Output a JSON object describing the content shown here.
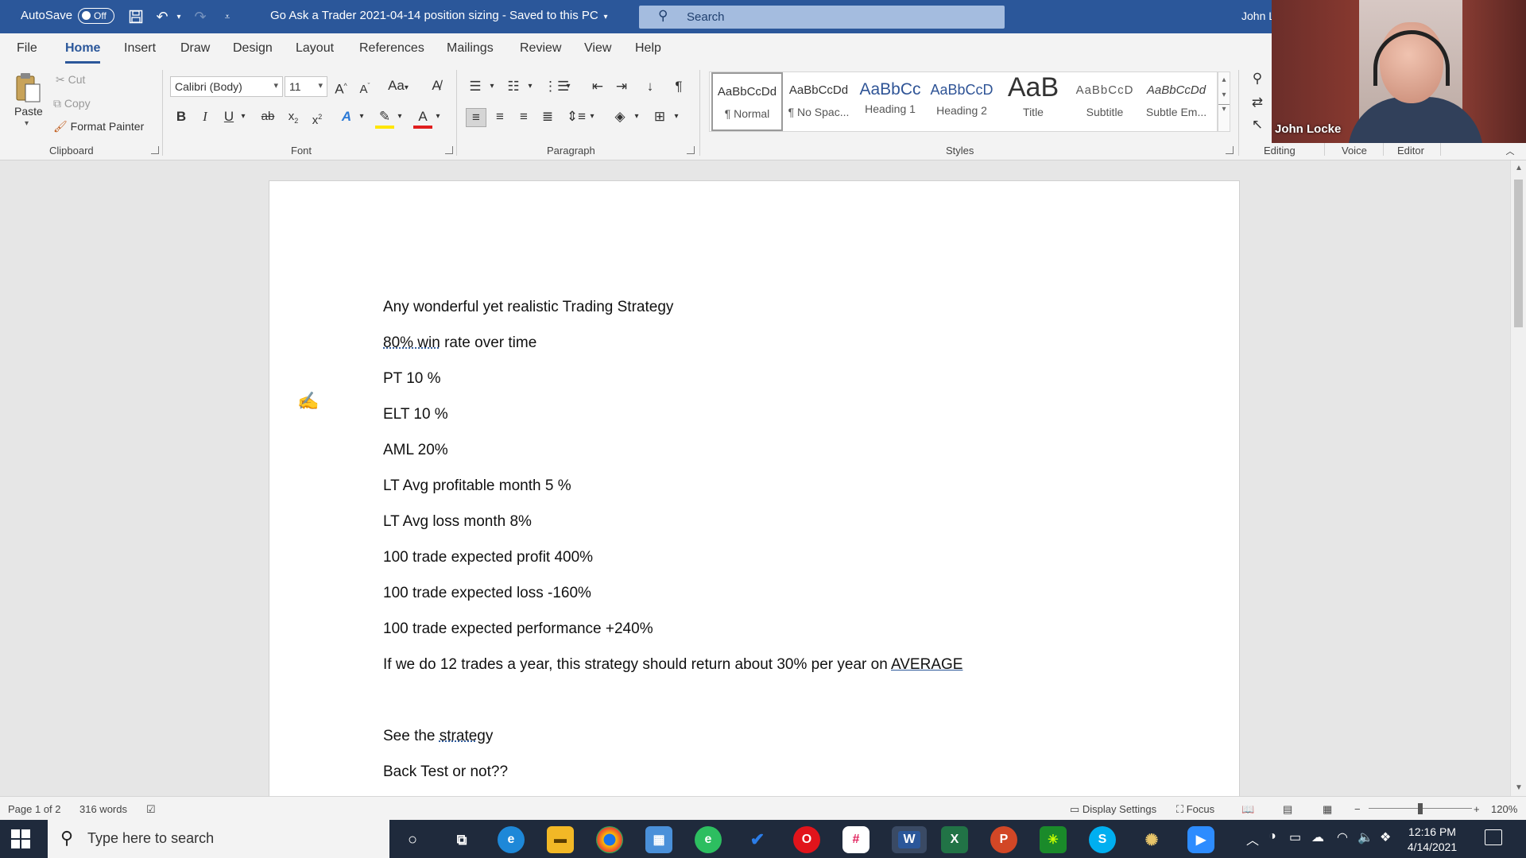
{
  "titlebar": {
    "autosave_label": "AutoSave",
    "autosave_state": "Off",
    "document_title": "Go Ask a Trader 2021-04-14 position sizing  -  Saved to this PC",
    "search_placeholder": "Search",
    "user": "John L"
  },
  "menu": {
    "tabs": [
      "File",
      "Home",
      "Insert",
      "Draw",
      "Design",
      "Layout",
      "References",
      "Mailings",
      "Review",
      "View",
      "Help"
    ],
    "active": "Home"
  },
  "ribbon": {
    "clipboard": {
      "paste": "Paste",
      "cut": "Cut",
      "copy": "Copy",
      "format_painter": "Format Painter",
      "group_label": "Clipboard"
    },
    "font": {
      "font_name": "Calibri (Body)",
      "font_size": "11",
      "change_case": "Aa",
      "group_label": "Font"
    },
    "paragraph": {
      "group_label": "Paragraph"
    },
    "styles": {
      "items": [
        {
          "preview": "AaBbCcDd",
          "name": "¶ Normal"
        },
        {
          "preview": "AaBbCcDd",
          "name": "¶ No Spac..."
        },
        {
          "preview": "AaBbCc",
          "name": "Heading 1"
        },
        {
          "preview": "AaBbCcD",
          "name": "Heading 2"
        },
        {
          "preview": "AaB",
          "name": "Title"
        },
        {
          "preview": "AaBbCcD",
          "name": "Subtitle"
        },
        {
          "preview": "AaBbCcDd",
          "name": "Subtle Em..."
        }
      ],
      "group_label": "Styles"
    },
    "editing_label": "Editing",
    "voice_label": "Voice",
    "editor_label": "Editor"
  },
  "webcam": {
    "name": "John Locke"
  },
  "document": {
    "lines": [
      {
        "text": "Any wonderful yet realistic Trading Strategy"
      },
      {
        "pre": "",
        "u": "80% win",
        "post": " rate over time"
      },
      {
        "text": "PT 10 %"
      },
      {
        "text": "ELT 10 %"
      },
      {
        "text": "AML 20%"
      },
      {
        "text": "LT Avg profitable month 5 %"
      },
      {
        "text": "LT Avg loss month 8%"
      },
      {
        "text": "100 trade expected profit 400%"
      },
      {
        "text": "100 trade expected loss -160%"
      },
      {
        "text": "100 trade expected performance +240%"
      },
      {
        "pre": "If we do 12 trades a year, this strategy should return about 30% per year on ",
        "u": "AVERAGE",
        "post": ""
      },
      {
        "pre": "See the ",
        "u": "strategy",
        "post": ""
      },
      {
        "text": "Back Test or not??"
      }
    ]
  },
  "statusbar": {
    "page": "Page 1 of 2",
    "words": "316 words",
    "display_settings": "Display Settings",
    "focus": "Focus",
    "zoom": "120%"
  },
  "taskbar": {
    "search_placeholder": "Type here to search",
    "time": "12:16 PM",
    "date": "4/14/2021"
  }
}
